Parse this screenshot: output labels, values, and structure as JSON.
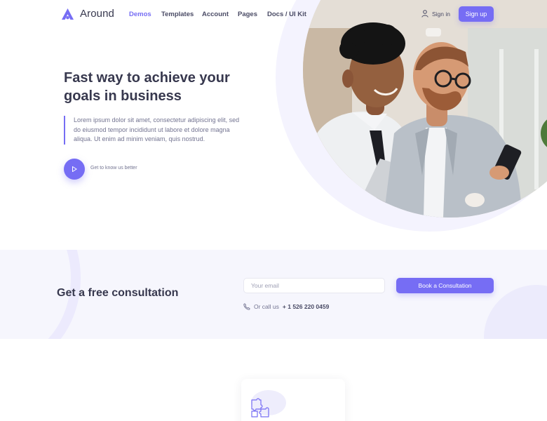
{
  "brand": {
    "name": "Around",
    "accent": "#766df4",
    "logo_icon": "around-logo-icon"
  },
  "nav": {
    "items": [
      "Demos",
      "Templates",
      "Account",
      "Pages",
      "Docs / UI Kit"
    ],
    "active": "Demos"
  },
  "header": {
    "signin_label": "Sign in",
    "signin_icon": "user-icon",
    "signup_label": "Sign up"
  },
  "hero": {
    "title": "Fast way to achieve your goals in business",
    "text": "Lorem ipsum dolor sit amet, consectetur adipiscing elit, sed do eiusmod tempor incididunt ut labore et dolore magna aliqua. Ut enim ad minim veniam, quis nostrud.",
    "video_label": "Get to know us better",
    "video_icon": "play-icon",
    "image_subject": "two businessmen looking at a laptop"
  },
  "consultation": {
    "title": "Get a free consultation",
    "email_placeholder": "Your email",
    "email_value": "",
    "button_label": "Book a Consultation",
    "call_label": "Or call us",
    "phone": "+ 1 526 220 0459",
    "phone_icon": "phone-icon"
  },
  "feature_card": {
    "icon": "puzzle-icon"
  }
}
